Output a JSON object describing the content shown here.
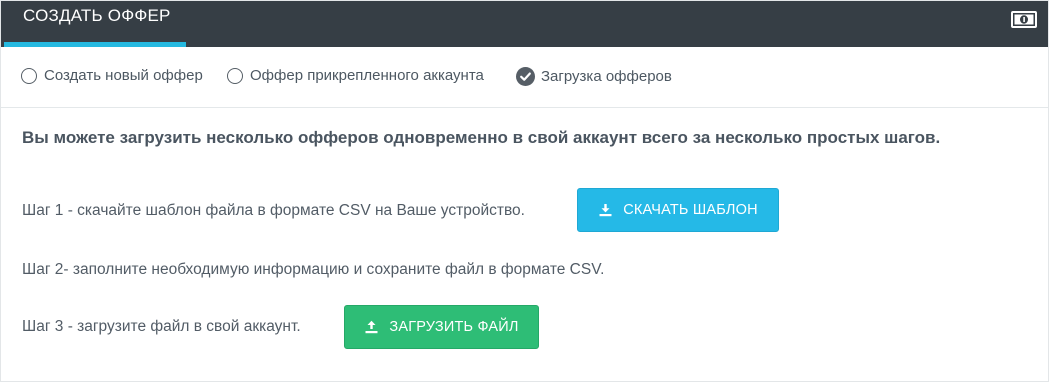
{
  "header": {
    "title": "СОЗДАТЬ ОФФЕР",
    "right_icon": "money-icon",
    "accent_color": "#25b9e0",
    "bar_color": "#363e45"
  },
  "options": [
    {
      "label": "Создать новый оффер",
      "selected": false
    },
    {
      "label": "Оффер прикрепленного аккаунта",
      "selected": false
    },
    {
      "label": "Загрузка офферов",
      "selected": true
    }
  ],
  "intro": "Вы можете загрузить несколько офферов одновременно в свой аккаунт всего за несколько простых шагов.",
  "steps": [
    {
      "text": "Шаг 1 - скачайте шаблон файла в формате CSV на Ваше устройство.",
      "button": "СКАЧАТЬ ШАБЛОН",
      "button_icon": "download-icon",
      "button_color": "#25b9e7"
    },
    {
      "text": "Шаг 2- заполните необходимую информацию и сохраните файл в формате CSV."
    },
    {
      "text": "Шаг 3 - загрузите файл в свой аккаунт.",
      "button": "ЗАГРУЗИТЬ ФАЙЛ",
      "button_icon": "upload-icon",
      "button_color": "#2ebd76"
    }
  ]
}
